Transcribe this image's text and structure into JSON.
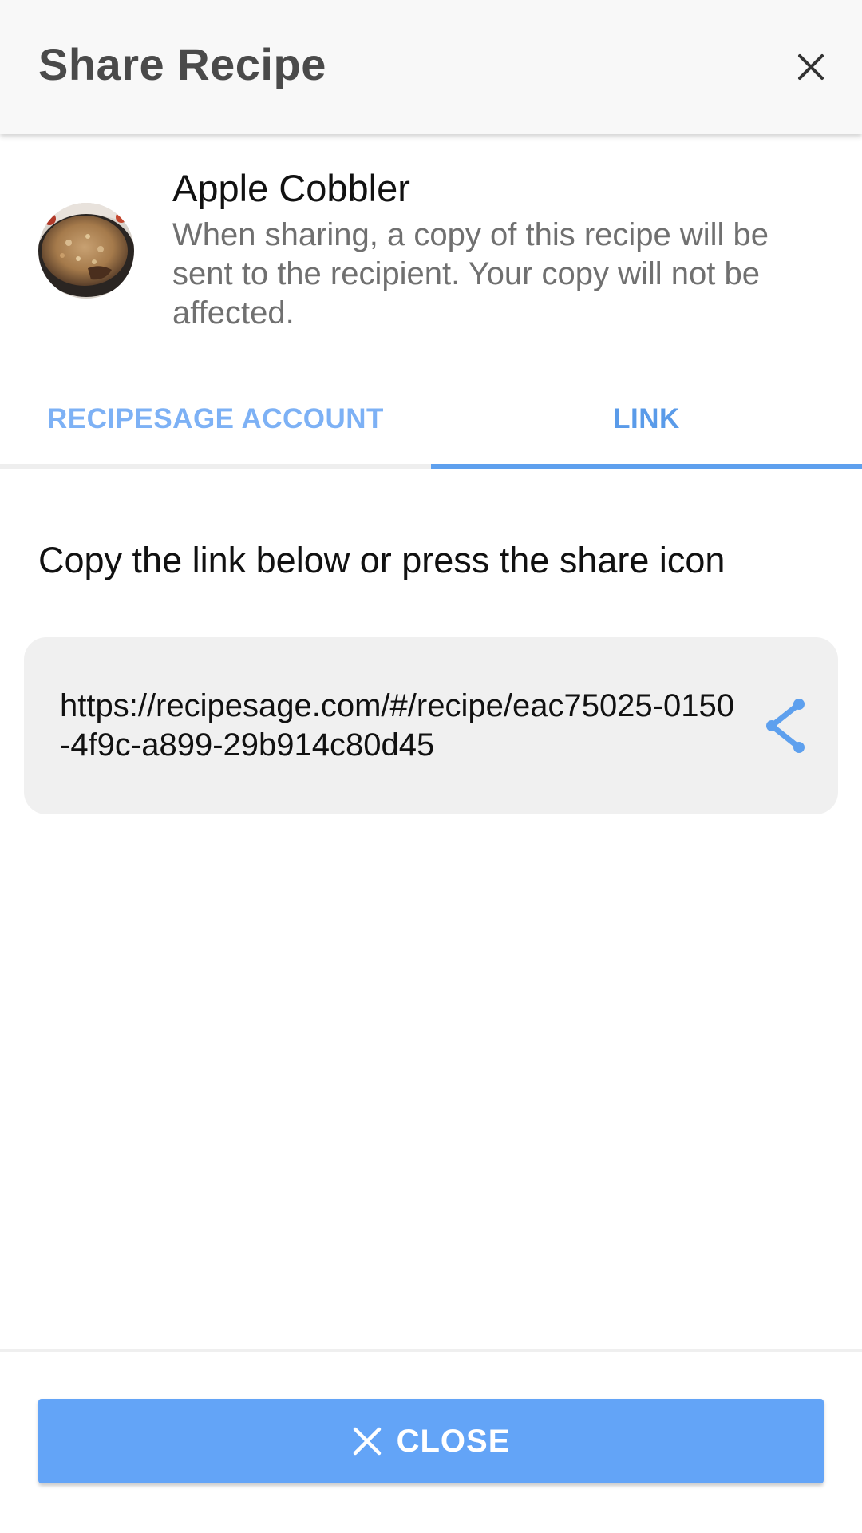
{
  "header": {
    "title": "Share Recipe",
    "close_icon": "close-icon"
  },
  "recipe": {
    "title": "Apple Cobbler",
    "description": "When sharing, a copy of this recipe will be sent to the recipient. Your copy will not be affected.",
    "thumbnail": "recipe-thumbnail"
  },
  "tabs": [
    {
      "label": "RECIPESAGE ACCOUNT",
      "selected": false
    },
    {
      "label": "LINK",
      "selected": true
    }
  ],
  "link_panel": {
    "instruction": "Copy the link below or press the share icon",
    "url": "https://recipesage.com/#/recipe/eac75025-0150-4f9c-a899-29b914c80d45",
    "share_icon": "share-icon"
  },
  "footer": {
    "close_label": "CLOSE",
    "close_icon": "close-icon"
  },
  "colors": {
    "accent": "#63a4f7",
    "tab_active": "#5a9be9",
    "tab_inactive": "#7db1f5",
    "header_bg": "#f8f8f8",
    "card_bg": "#f0f0f0"
  }
}
